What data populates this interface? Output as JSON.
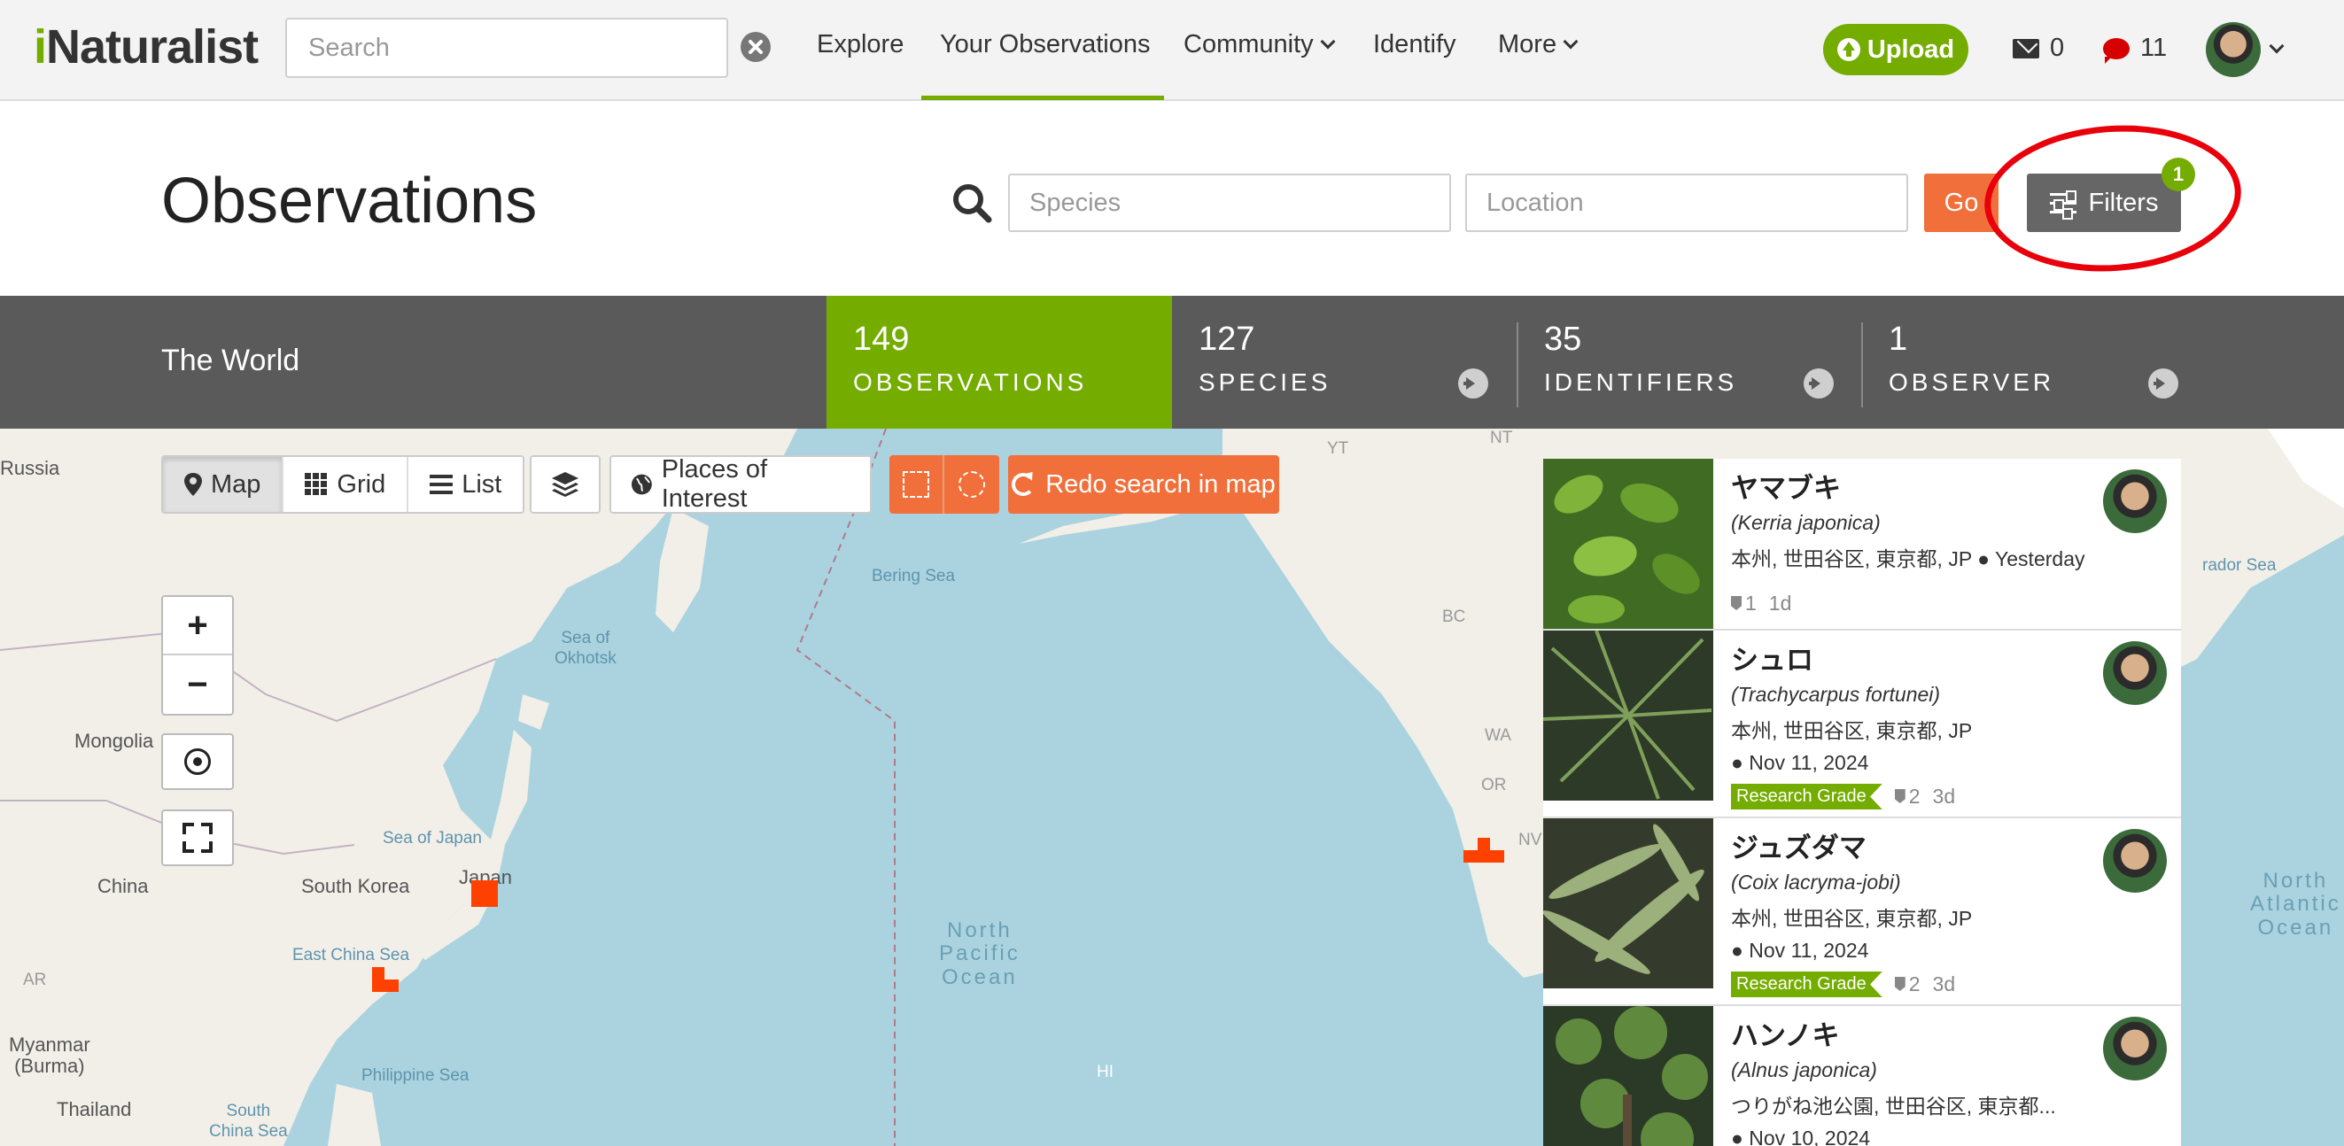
{
  "header": {
    "logo": "iNaturalist",
    "search_placeholder": "Search",
    "nav": [
      {
        "label": "Explore"
      },
      {
        "label": "Your Observations"
      },
      {
        "label": "Community"
      },
      {
        "label": "Identify"
      },
      {
        "label": "More"
      }
    ],
    "upload_label": "Upload",
    "messages_count": "0",
    "notifications_count": "11"
  },
  "title_row": {
    "title": "Observations",
    "species_placeholder": "Species",
    "location_placeholder": "Location",
    "go_label": "Go",
    "filters_label": "Filters",
    "filters_badge": "1"
  },
  "stats": {
    "place": "The World",
    "items": [
      {
        "num": "149",
        "label": "OBSERVATIONS"
      },
      {
        "num": "127",
        "label": "SPECIES"
      },
      {
        "num": "35",
        "label": "IDENTIFIERS"
      },
      {
        "num": "1",
        "label": "OBSERVER"
      }
    ]
  },
  "map_controls": {
    "view_map": "Map",
    "view_grid": "Grid",
    "view_list": "List",
    "places_of_interest": "Places of Interest",
    "redo_search": "Redo search in map",
    "zoom_in": "+",
    "zoom_out": "−"
  },
  "map_labels": {
    "russia": "Russia",
    "mongolia": "Mongolia",
    "china": "China",
    "south_korea": "South Korea",
    "japan": "Japan",
    "myanmar": "Myanmar\n(Burma)",
    "thailand": "Thailand",
    "bering_sea": "Bering Sea",
    "sea_of_okhotsk": "Sea of\nOkhotsk",
    "sea_of_japan": "Sea of Japan",
    "east_china_sea": "East China Sea",
    "philippine_sea": "Philippine Sea",
    "south_china_sea": "South\nChina Sea",
    "north_pacific": "North\nPacific\nOcean",
    "north_atlantic": "North\nAtlantic\nOcean",
    "labrador_sea": "rador Sea",
    "hi": "HI",
    "yt": "YT",
    "nt": "NT",
    "bc": "BC",
    "wa": "WA",
    "or": "OR",
    "nv": "NV",
    "ar": "AR"
  },
  "observations": [
    {
      "common": "ヤマブキ",
      "scientific": "(Kerria japonica)",
      "place": "本州, 世田谷区, 東京都, JP",
      "date": "● Yesterday",
      "ids": "1",
      "ago": "1d",
      "grade": ""
    },
    {
      "common": "シュロ",
      "scientific": "(Trachycarpus fortunei)",
      "place": "本州, 世田谷区, 東京都, JP",
      "date": "● Nov 11, 2024",
      "ids": "2",
      "ago": "3d",
      "grade": "Research Grade"
    },
    {
      "common": "ジュズダマ",
      "scientific": "(Coix lacryma-jobi)",
      "place": "本州, 世田谷区, 東京都, JP",
      "date": "● Nov 11, 2024",
      "ids": "2",
      "ago": "3d",
      "grade": "Research Grade"
    },
    {
      "common": "ハンノキ",
      "scientific": "(Alnus japonica)",
      "place": "つりがね池公園, 世田谷区, 東京都...",
      "date": "● Nov 10, 2024",
      "ids": "",
      "ago": "",
      "grade": ""
    }
  ],
  "colors": {
    "brand_green": "#74ac00",
    "action_orange": "#f16f3a",
    "observation_square": "#ff4100",
    "annotation_red": "#e8000b"
  }
}
